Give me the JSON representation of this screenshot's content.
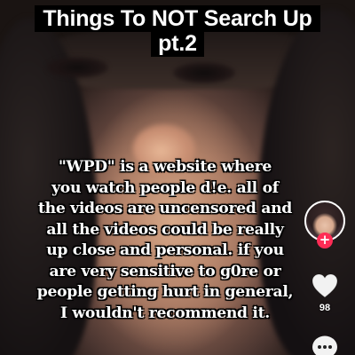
{
  "title": {
    "line1": "Things To NOT Search Up",
    "line2": "pt.2"
  },
  "caption": {
    "lines": [
      "\"WPD\" is a website where",
      "you watch people d!e. all of",
      "the videos are uncensored and",
      "all the videos could be really",
      "up close and personal. if you",
      "are very sensitive to g0re or",
      "people getting hurt in general,",
      "I wouldn't recommend it."
    ]
  },
  "sidebar": {
    "follow_symbol": "+",
    "like_count": "98",
    "accent_color": "#fe2c55",
    "icons": [
      "avatar",
      "heart-icon",
      "comment-icon"
    ]
  }
}
